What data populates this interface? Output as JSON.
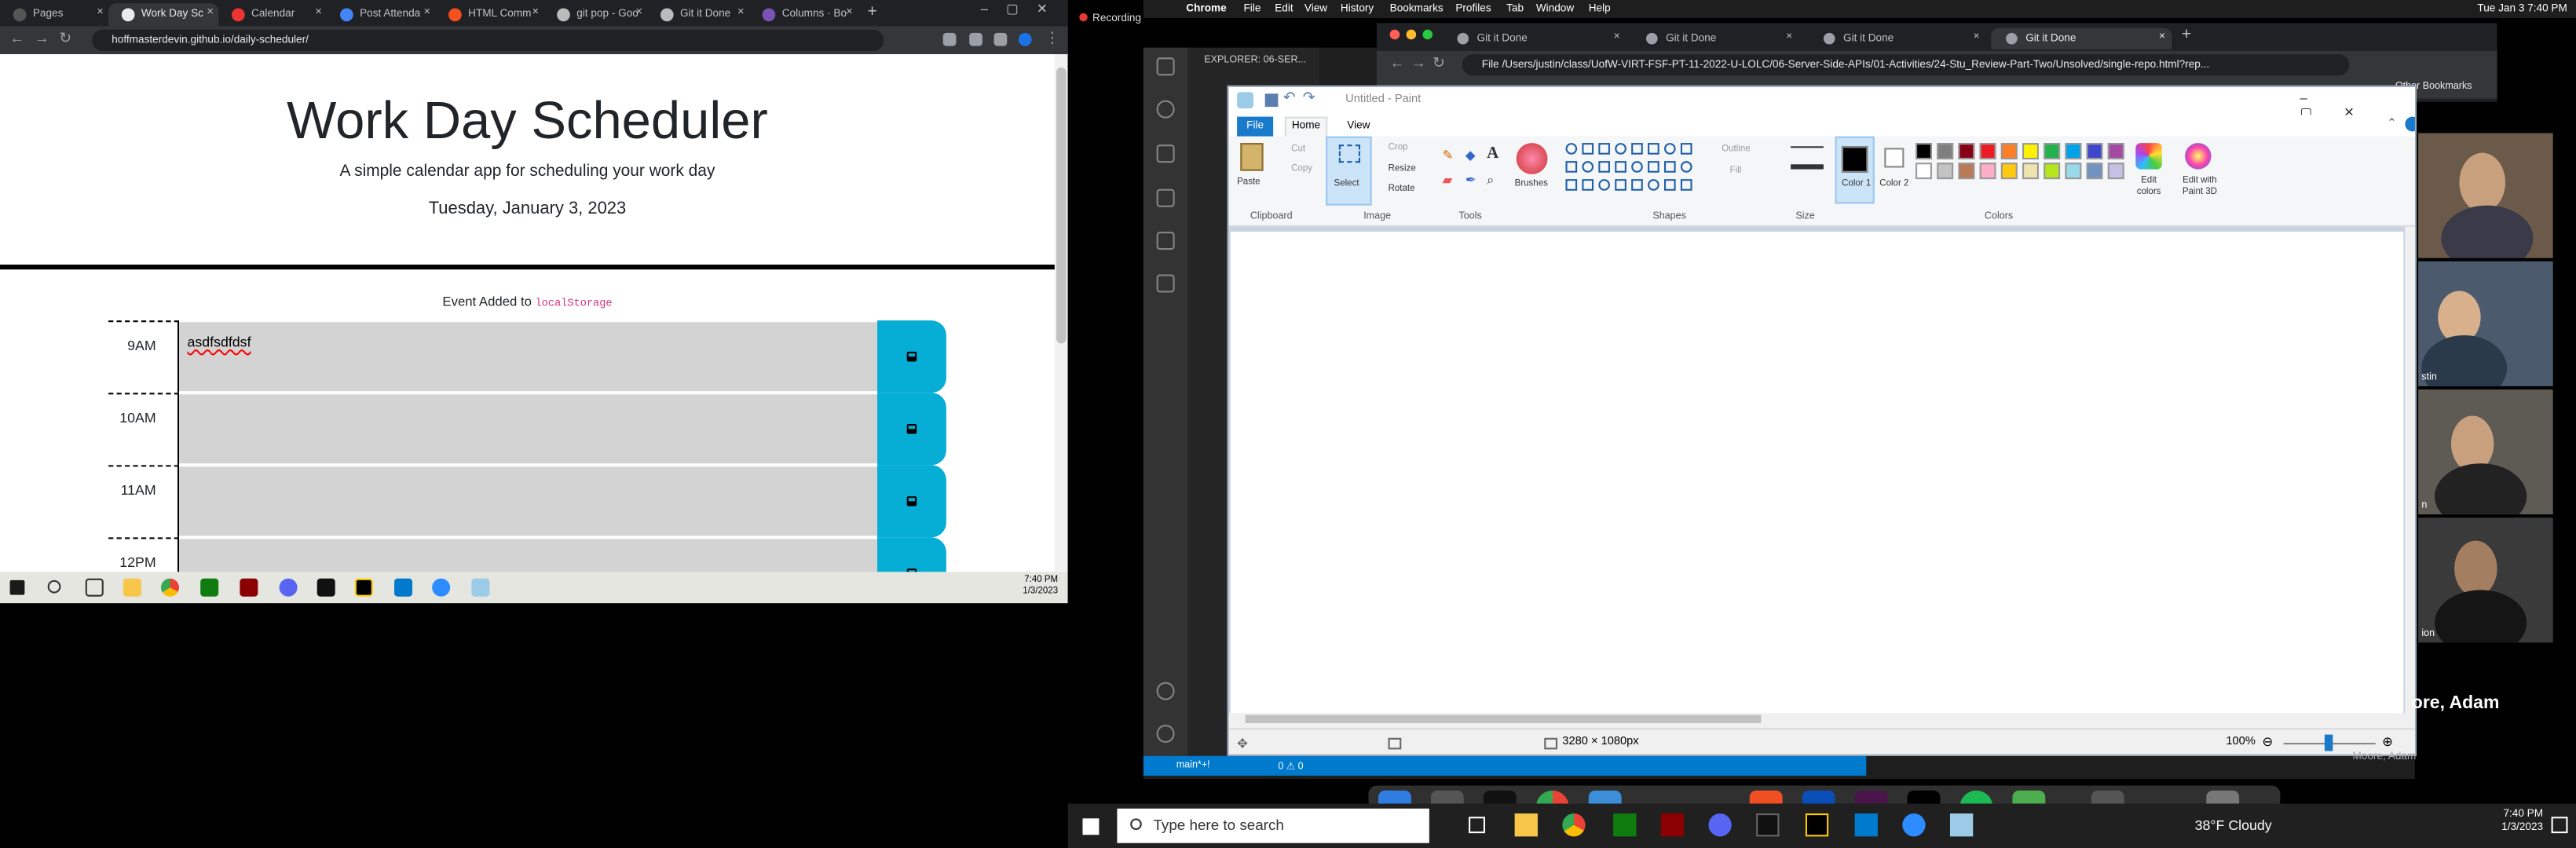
{
  "left_browser": {
    "tabs": [
      {
        "label": "Pages",
        "active": false
      },
      {
        "label": "Work Day Sc",
        "active": true
      },
      {
        "label": "Calendar",
        "active": false
      },
      {
        "label": "Post Attenda",
        "active": false
      },
      {
        "label": "HTML Comm",
        "active": false
      },
      {
        "label": "git pop - Goo",
        "active": false
      },
      {
        "label": "Git it Done",
        "active": false
      },
      {
        "label": "Columns · Bo",
        "active": false
      }
    ],
    "url": "hoffmasterdevin.github.io/daily-scheduler/",
    "page": {
      "title": "Work Day Scheduler",
      "lead": "A simple calendar app for scheduling your work day",
      "date": "Tuesday, January 3, 2023",
      "notice_text": "Event Added to",
      "notice_code": "localStorage",
      "rows": [
        {
          "hour": "9AM",
          "text": "asdfsdfdsf"
        },
        {
          "hour": "10AM",
          "text": ""
        },
        {
          "hour": "11AM",
          "text": ""
        },
        {
          "hour": "12PM",
          "text": ""
        }
      ]
    },
    "taskbar_time": "7:40 PM",
    "taskbar_date": "1/3/2023"
  },
  "mac": {
    "recording": "Recording",
    "menus": [
      "Chrome",
      "File",
      "Edit",
      "View",
      "History",
      "Bookmarks",
      "Profiles",
      "Tab",
      "Window",
      "Help"
    ],
    "clock": "Tue Jan 3  7:40 PM"
  },
  "vscode": {
    "explorer_title": "EXPLORER: 06-SER...",
    "status_branch": "main*+!",
    "status_problems": "0 ⚠ 0"
  },
  "right_browser": {
    "tabs": [
      "Git it Done",
      "Git it Done",
      "Git it Done",
      "Git it Done"
    ],
    "url": "File  /Users/justin/class/UofW-VIRT-FSF-PT-11-2022-U-LOLC/06-Server-Side-APIs/01-Activities/24-Stu_Review-Part-Two/Unsolved/single-repo.html?rep...",
    "bookmarks": "Other Bookmarks"
  },
  "paint": {
    "title": "Untitled - Paint",
    "menu": {
      "file": "File",
      "home": "Home",
      "view": "View"
    },
    "clipboard": {
      "paste": "Paste",
      "cut": "Cut",
      "copy": "Copy",
      "group": "Clipboard"
    },
    "image": {
      "select": "Select",
      "crop": "Crop",
      "resize": "Resize",
      "rotate": "Rotate",
      "group": "Image"
    },
    "tools_group": "Tools",
    "brushes": "Brushes",
    "shapes": {
      "outline": "Outline",
      "fill": "Fill",
      "group": "Shapes"
    },
    "size": "Size",
    "color1": "Color 1",
    "color2": "Color 2",
    "colors_group": "Colors",
    "edit_colors": "Edit colors",
    "edit_3d": "Edit with Paint 3D",
    "palette": [
      "#000000",
      "#7f7f7f",
      "#880015",
      "#ed1c24",
      "#ff7f27",
      "#fff200",
      "#22b14c",
      "#00a2e8",
      "#3f48cc",
      "#a349a4",
      "#ffffff",
      "#c3c3c3",
      "#b97a57",
      "#ffaec9",
      "#ffc90e",
      "#efe4b0",
      "#b5e61d",
      "#99d9ea",
      "#7092be",
      "#c8bfe7"
    ],
    "dimensions": "3280 × 1080px",
    "zoom": "100%"
  },
  "zoom": {
    "participant_names": [
      "stin",
      "n",
      "ion"
    ],
    "speaker": "ore, Adam",
    "speaker_small": "Moore, Adam"
  },
  "right_taskbar": {
    "search_placeholder": "Type here to search",
    "weather": "38°F  Cloudy",
    "time": "7:40 PM",
    "date": "1/3/2023"
  }
}
